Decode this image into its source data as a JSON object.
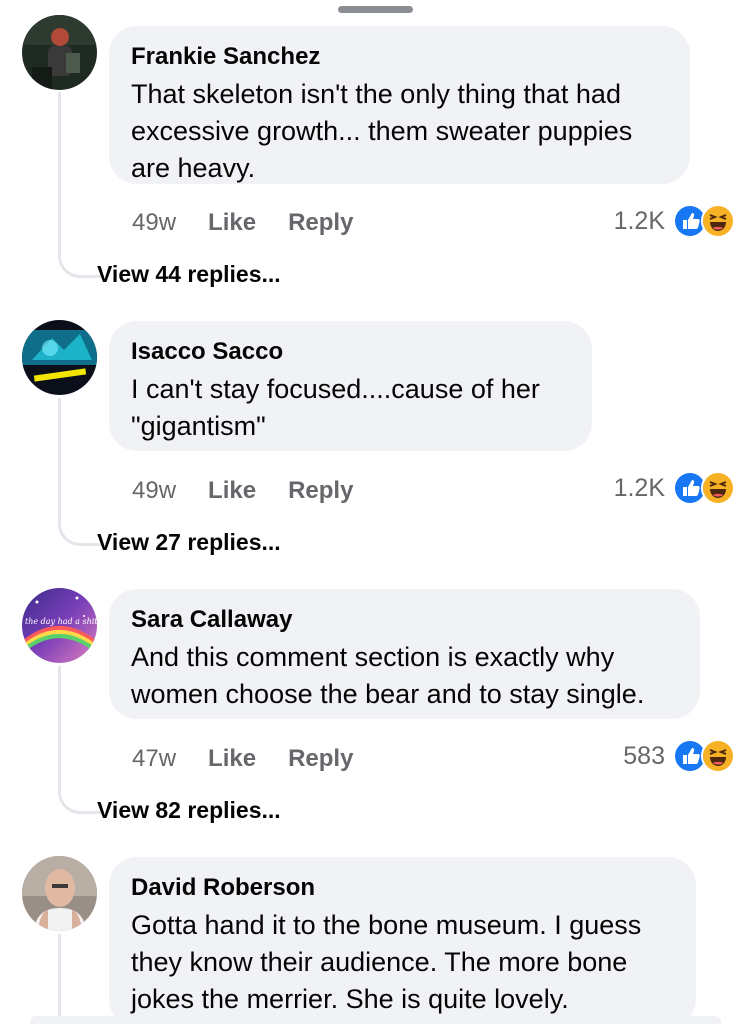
{
  "sheet": {
    "handle_label": ""
  },
  "reaction_colors": {
    "like": "#1877f2",
    "haha": "#f7b125"
  },
  "comments": [
    {
      "author": "Frankie Sanchez",
      "text": "That skeleton isn't the only thing that had excessive growth... them sweater puppies are heavy.",
      "time": "49w",
      "like_label": "Like",
      "reply_label": "Reply",
      "reaction_count": "1.2K",
      "reactions": [
        "like-icon",
        "haha-icon"
      ],
      "view_replies": "View 44 replies..."
    },
    {
      "author": "Isacco Sacco",
      "text": "I can't stay focused....cause of her \"gigantism\"",
      "time": "49w",
      "like_label": "Like",
      "reply_label": "Reply",
      "reaction_count": "1.2K",
      "reactions": [
        "like-icon",
        "haha-icon"
      ],
      "view_replies": "View 27 replies..."
    },
    {
      "author": "Sara Callaway",
      "text": "And this comment section is exactly why women choose the bear and to stay single.",
      "time": "47w",
      "like_label": "Like",
      "reply_label": "Reply",
      "reaction_count": "583",
      "reactions": [
        "like-icon",
        "haha-icon"
      ],
      "view_replies": "View 82 replies...",
      "avatar_text": "maybe the day had a shitty you"
    },
    {
      "author": "David Roberson",
      "text": "Gotta hand it to the bone museum. I guess they know their audience. The more bone jokes the merrier. She is quite lovely."
    }
  ]
}
